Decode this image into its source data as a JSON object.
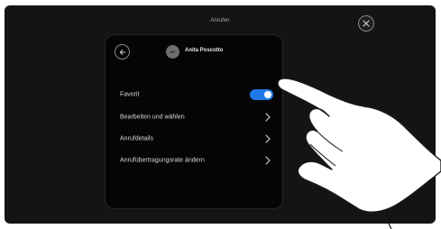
{
  "topbar": {
    "title": "Anrufen"
  },
  "contact": {
    "initials": "AP",
    "name": "Anita Poscotto"
  },
  "settings": [
    {
      "label": "Favorit",
      "control": "toggle",
      "value": true
    },
    {
      "label": "Bearbeiten und wählen",
      "control": "chevron"
    },
    {
      "label": "Anrufdetails",
      "control": "chevron"
    },
    {
      "label": "Anrufübertragungsrate ändern",
      "control": "chevron"
    }
  ],
  "colors": {
    "accent": "#1f78e6",
    "background": "#141414",
    "panel": "#050505"
  },
  "icons": [
    "close-icon",
    "back-arrow-icon",
    "chevron-right-icon"
  ]
}
